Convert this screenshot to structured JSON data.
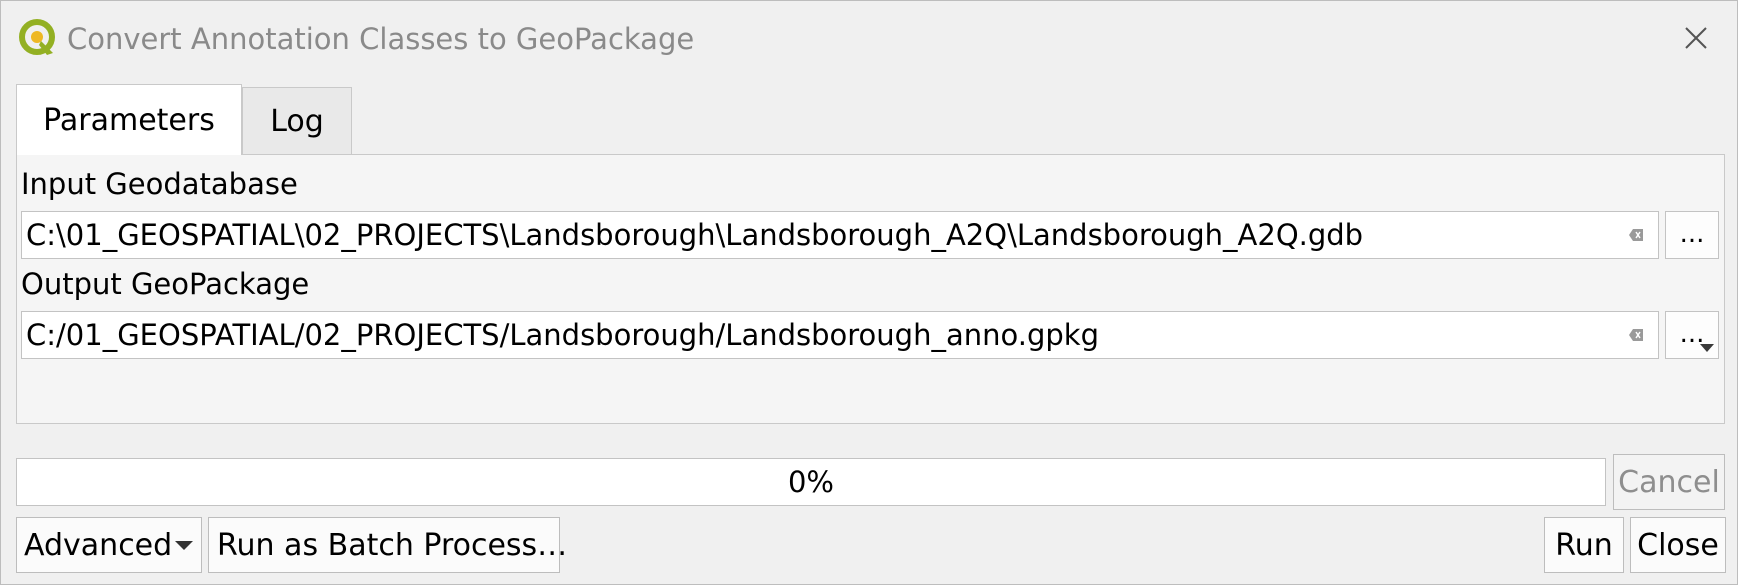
{
  "window": {
    "title": "Convert Annotation Classes to GeoPackage",
    "icon": "qgis-logo-icon",
    "close_icon": "close-icon"
  },
  "tabs": [
    {
      "label": "Parameters",
      "active": true
    },
    {
      "label": "Log",
      "active": false
    }
  ],
  "parameters": {
    "input_geodatabase": {
      "label": "Input Geodatabase",
      "value": "C:\\01_GEOSPATIAL\\02_PROJECTS\\Landsborough\\Landsborough_A2Q\\Landsborough_A2Q.gdb",
      "browse_label": "..."
    },
    "output_geopackage": {
      "label": "Output GeoPackage",
      "value": "C:/01_GEOSPATIAL/02_PROJECTS/Landsborough/Landsborough_anno.gpkg",
      "browse_label": "..."
    }
  },
  "progress": {
    "percent": 0,
    "text": "0%"
  },
  "buttons": {
    "cancel": "Cancel",
    "advanced": "Advanced",
    "batch": "Run as Batch Process…",
    "run": "Run",
    "close": "Close"
  },
  "colors": {
    "background": "#f0f0f0",
    "disabled_text": "#8e8e8e",
    "qgis_green": "#93b023",
    "qgis_yellow": "#eeb825"
  }
}
